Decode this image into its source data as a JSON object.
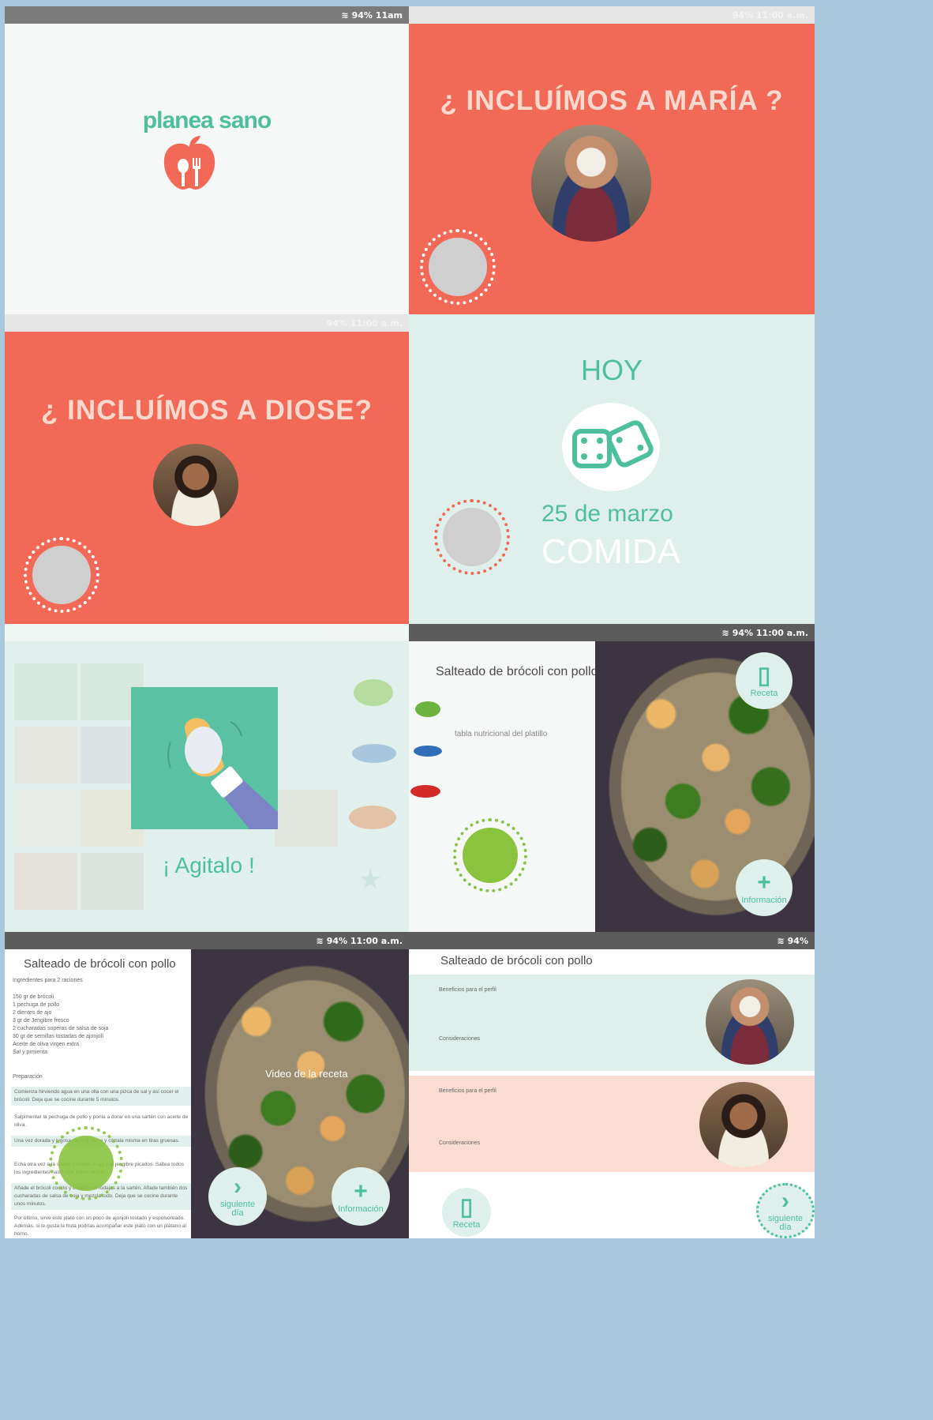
{
  "status": {
    "battery": "94%",
    "time_short": "11am",
    "time_full": "11:00 a.m.",
    "time_bold": "11:00 a.m."
  },
  "splash": {
    "brand": "planea sano"
  },
  "maria_screen": {
    "question": "¿ INCLUÍMOS A MARÍA ?"
  },
  "diose_screen": {
    "question": "¿ INCLUÍMOS A DIOSE?"
  },
  "today_screen": {
    "title": "HOY",
    "date": "25 de marzo",
    "meal": "COMIDA"
  },
  "shake_screen": {
    "label": "¡ Agitalo !"
  },
  "dish_screen": {
    "dish_title": "Salteado de brócoli con pollo",
    "nutrition_label": "tabla nutricional del platillo",
    "recipe_button": "Receta",
    "info_button": "Información"
  },
  "recipe_screen": {
    "dish_title": "Salteado de brócoli con pollo",
    "servings": "Ingredientes para 2 raciones",
    "ingredients": [
      "150 gr de brócoli",
      "1 pechuga de pollo",
      "2 dientes de ajo",
      "3 gr de Jengibre fresco",
      "2 cucharadas soperas de salsa de soja",
      "30 gr de semillas tostadas de ajonjolí",
      "Aceite de oliva virgen extra",
      "Sal y pimienta"
    ],
    "prep_label": "Preparación",
    "steps": [
      "Comienza hirviendo agua en una olla con una pizca de sal y así cocer el brócoli. Deja que se cocine durante 5 minutos.",
      "Salpimentar la pechuga de pollo y ponla a dorar en una sartén con aceite de oliva.",
      "Una vez dorada y jugosa saca la carne y córtala misma en tiras gruesas.",
      "Echa otra vez a la sartén y añade el ajo y el jengibre picados. Saltea todos los ingredientes hasta que estén hechos.",
      "Añade el brócoli cocido y cortado en rodajas a la sartén. Añade también dos cucharadas de salsa de soja y mezcla todo. Deja que se cocine durante unos minutos.",
      "Por último, sirve este plato con un poco de ajonjolí tostado y espolvoreado. Además, si te gusta la fruta podrías acompañar este plato con un plátano al horno."
    ],
    "video_label": "Video de la receta",
    "next_button": "siguiente día",
    "info_button": "Información"
  },
  "profile_screen": {
    "dish_title": "Salteado de brócoli con pollo",
    "benefits_label": "Beneficios para el perfil",
    "considerations_label": "Consideraciones",
    "recipe_button": "Receta",
    "next_button": "siguiente día"
  },
  "colors": {
    "coral": "#f26a57",
    "mint": "#dff0ec",
    "teal": "#4dbf9c",
    "green": "#8ac43f"
  }
}
